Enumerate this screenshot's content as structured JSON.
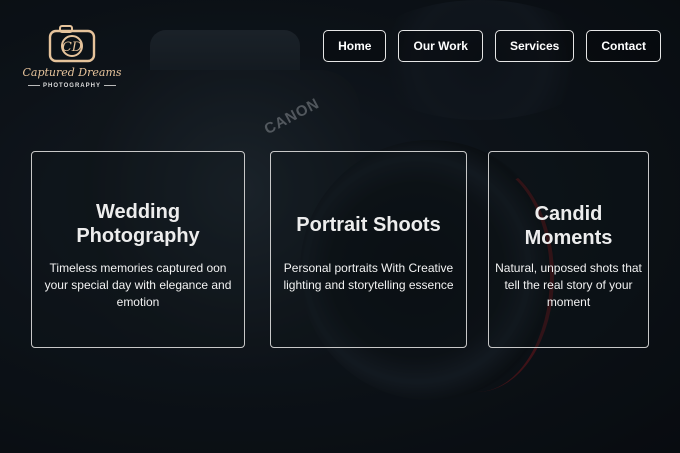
{
  "logo": {
    "script": "Captured Dreams",
    "subtitle": "PHOTOGRAPHY",
    "icon": "camera-icon",
    "accent": "#e6c39b"
  },
  "background": {
    "brand_text": "CANON"
  },
  "nav": {
    "items": [
      {
        "label": "Home"
      },
      {
        "label": "Our Work"
      },
      {
        "label": "Services"
      },
      {
        "label": "Contact"
      }
    ]
  },
  "cards": [
    {
      "title": "Wedding Photography",
      "description": "Timeless memories captured oon your special day with elegance and emotion"
    },
    {
      "title": "Portrait Shoots",
      "description": "Personal portraits With Creative lighting and storytelling essence"
    },
    {
      "title": "Candid Moments",
      "description": "Natural, unposed shots that tell the real story of your moment"
    }
  ]
}
